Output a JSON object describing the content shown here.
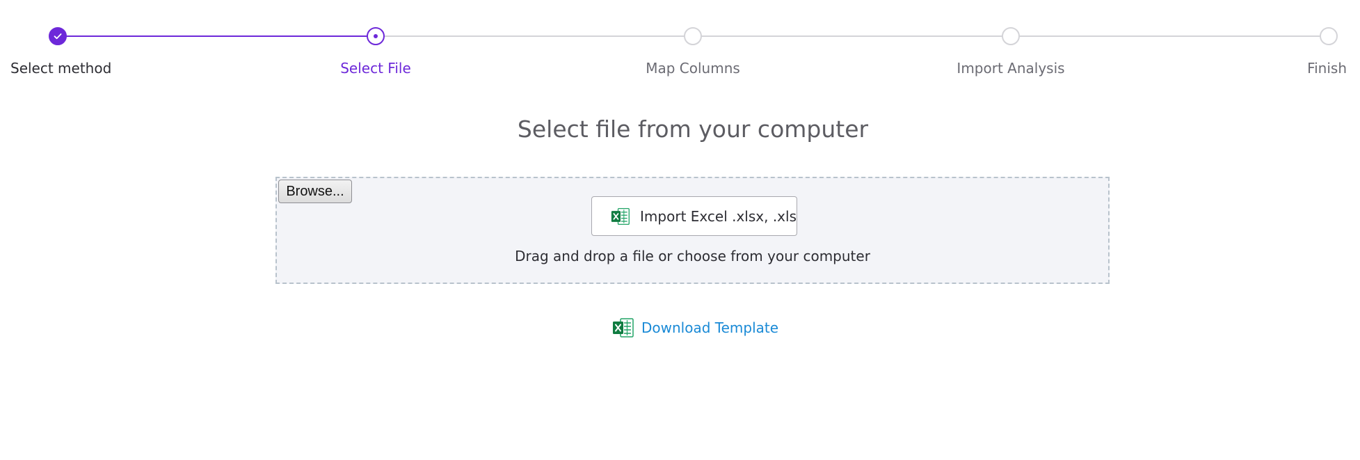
{
  "stepper": {
    "steps": [
      {
        "label": "Select method",
        "state": "completed"
      },
      {
        "label": "Select File",
        "state": "current"
      },
      {
        "label": "Map Columns",
        "state": "upcoming"
      },
      {
        "label": "Import Analysis",
        "state": "upcoming"
      },
      {
        "label": "Finish",
        "state": "upcoming"
      }
    ],
    "accent_color": "#6d28d9",
    "inactive_color": "#d4d4d8"
  },
  "upload": {
    "heading": "Select file from your computer",
    "browse_label": "Browse...",
    "import_button_label": "Import Excel .xlsx, .xls",
    "import_icon": "excel-icon",
    "drop_hint": "Drag and drop a file or choose from your computer"
  },
  "template": {
    "download_label": "Download Template",
    "icon": "excel-icon",
    "link_color": "#1a8ad6"
  }
}
